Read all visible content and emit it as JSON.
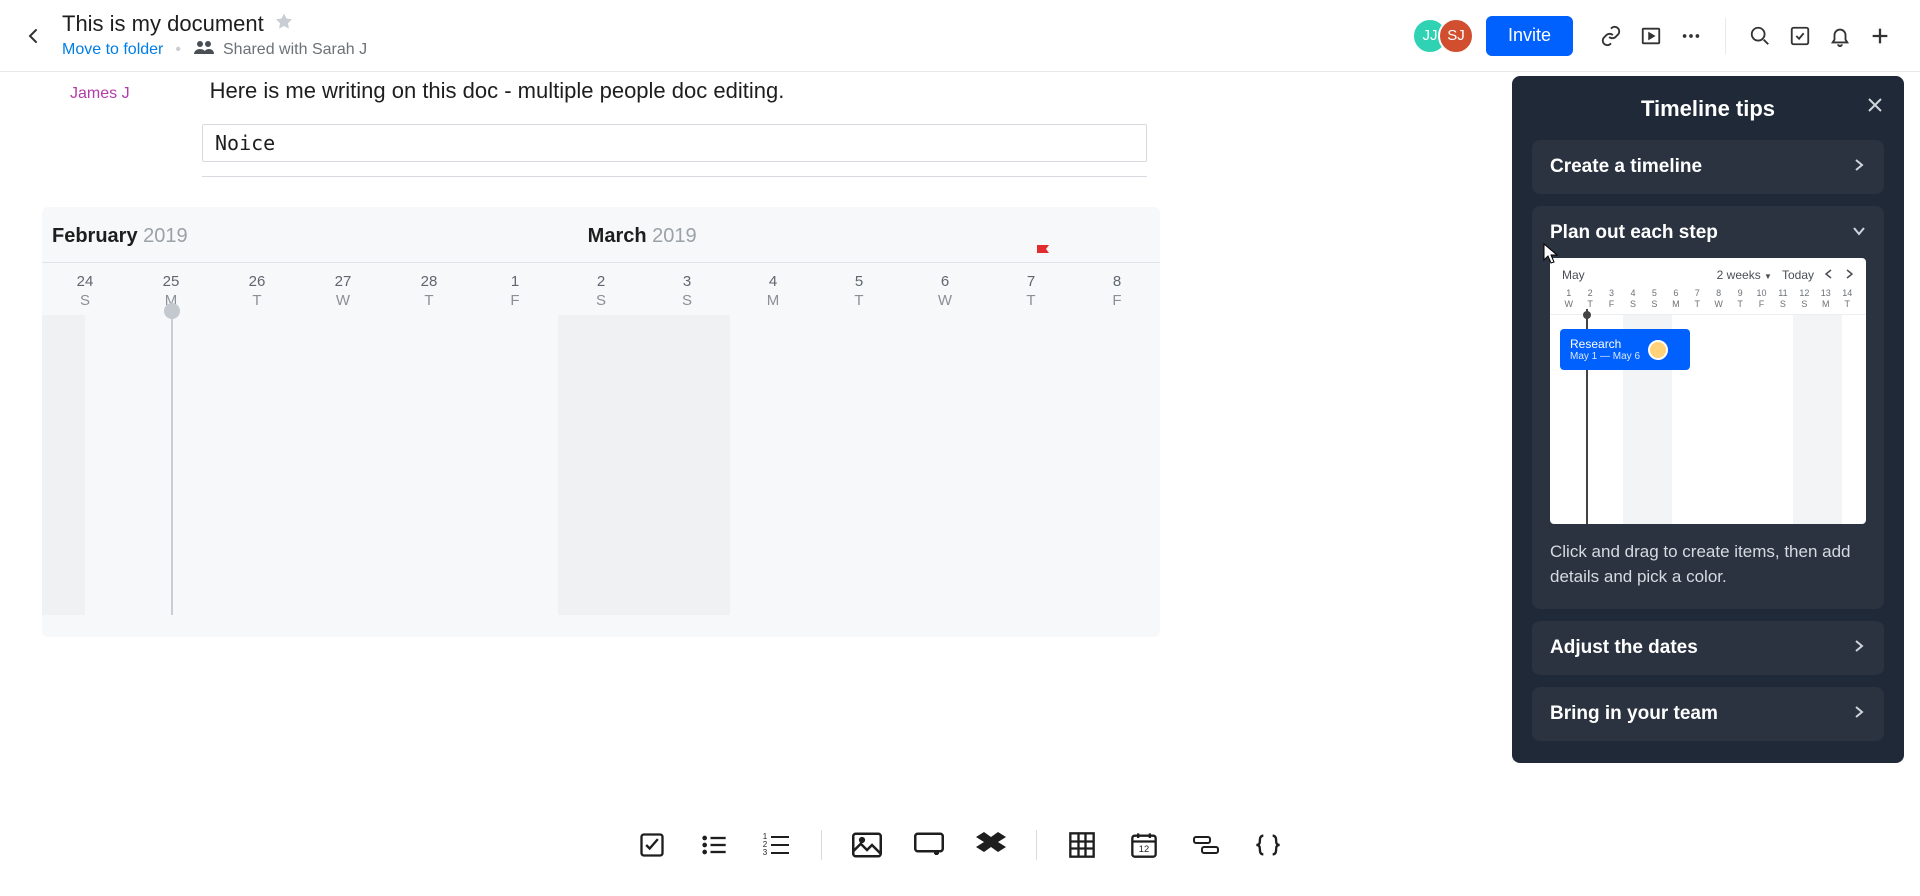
{
  "header": {
    "title": "This is my document",
    "move_label": "Move to folder",
    "shared_label": "Shared with Sarah J",
    "invite_label": "Invite",
    "avatars": [
      {
        "initials": "JJ"
      },
      {
        "initials": "SJ"
      }
    ]
  },
  "doc": {
    "collab_name": "James J",
    "collab_text": "Here is me writing on this doc - multiple people doc editing.",
    "code": "Noice"
  },
  "timeline": {
    "months": [
      {
        "name": "February",
        "year": "2019"
      },
      {
        "name": "March",
        "year": "2019"
      }
    ],
    "days": [
      {
        "n": "24",
        "d": "S"
      },
      {
        "n": "25",
        "d": "M"
      },
      {
        "n": "26",
        "d": "T"
      },
      {
        "n": "27",
        "d": "W"
      },
      {
        "n": "28",
        "d": "T"
      },
      {
        "n": "1",
        "d": "F"
      },
      {
        "n": "2",
        "d": "S"
      },
      {
        "n": "3",
        "d": "S"
      },
      {
        "n": "4",
        "d": "M"
      },
      {
        "n": "5",
        "d": "T"
      },
      {
        "n": "6",
        "d": "W"
      },
      {
        "n": "7",
        "d": "T"
      },
      {
        "n": "8",
        "d": "F"
      }
    ]
  },
  "tips": {
    "title": "Timeline tips",
    "items": [
      {
        "label": "Create a timeline"
      },
      {
        "label": "Plan out each step"
      },
      {
        "label": "Adjust the dates"
      },
      {
        "label": "Bring in your team"
      }
    ],
    "mini": {
      "month": "May",
      "range": "2 weeks",
      "today": "Today",
      "days": [
        {
          "n": "1",
          "d": "W"
        },
        {
          "n": "2",
          "d": "T"
        },
        {
          "n": "3",
          "d": "F"
        },
        {
          "n": "4",
          "d": "S"
        },
        {
          "n": "5",
          "d": "S"
        },
        {
          "n": "6",
          "d": "M"
        },
        {
          "n": "7",
          "d": "T"
        },
        {
          "n": "8",
          "d": "W"
        },
        {
          "n": "9",
          "d": "T"
        },
        {
          "n": "10",
          "d": "F"
        },
        {
          "n": "11",
          "d": "S"
        },
        {
          "n": "12",
          "d": "S"
        },
        {
          "n": "13",
          "d": "M"
        },
        {
          "n": "14",
          "d": "T"
        }
      ],
      "event_title": "Research",
      "event_range": "May 1 — May 6"
    },
    "desc": "Click and drag to create items, then add details and pick a color."
  }
}
